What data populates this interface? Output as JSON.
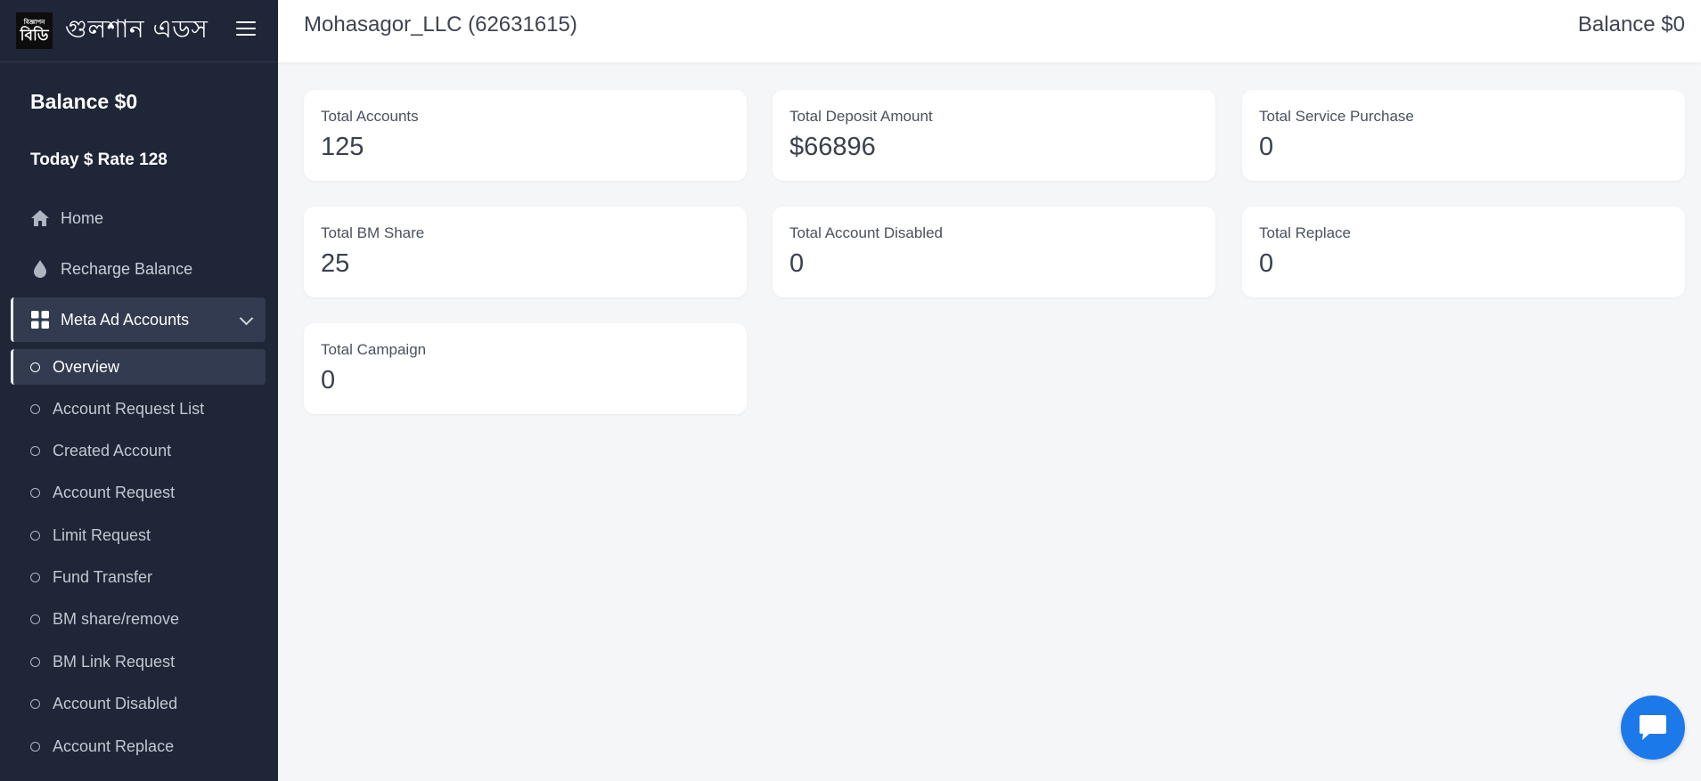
{
  "brand": {
    "logo_small": "বিজ্ঞাপন",
    "logo_big": "বিডি",
    "name": "গুলশান এডস"
  },
  "sidebar": {
    "balance": "Balance $0",
    "rate": "Today $ Rate 128",
    "nav": [
      {
        "label": "Home",
        "icon": "home-icon"
      },
      {
        "label": "Recharge Balance",
        "icon": "drop-icon"
      },
      {
        "label": "Meta Ad Accounts",
        "icon": "grid-icon"
      }
    ],
    "submenu": [
      "Overview",
      "Account Request List",
      "Created Account",
      "Account Request",
      "Limit Request",
      "Fund Transfer",
      "BM share/remove",
      "BM Link Request",
      "Account Disabled",
      "Account Replace"
    ]
  },
  "header": {
    "title": "Mohasagor_LLC (62631615)",
    "balance": "Balance $0"
  },
  "cards": [
    {
      "label": "Total Accounts",
      "value": "125"
    },
    {
      "label": "Total Deposit Amount",
      "value": "$66896"
    },
    {
      "label": "Total Service Purchase",
      "value": "0"
    },
    {
      "label": "Total BM Share",
      "value": "25"
    },
    {
      "label": "Total Account Disabled",
      "value": "0"
    },
    {
      "label": "Total Replace",
      "value": "0"
    },
    {
      "label": "Total Campaign",
      "value": "0"
    }
  ],
  "colors": {
    "sidebar_bg": "#1f2637",
    "chat_button": "#1c79ea"
  }
}
